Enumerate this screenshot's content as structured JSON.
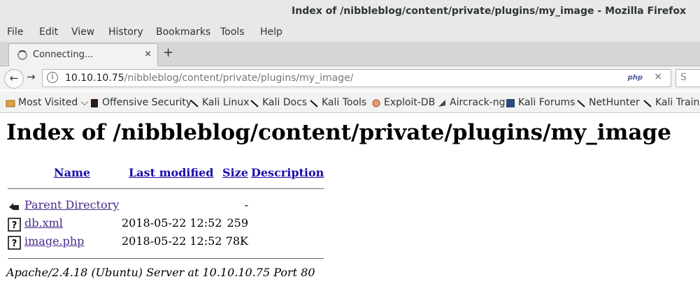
{
  "window": {
    "title": "Index of /nibbleblog/content/private/plugins/my_image - Mozilla Firefox"
  },
  "menu": [
    "File",
    "Edit",
    "View",
    "History",
    "Bookmarks",
    "Tools",
    "Help"
  ],
  "tab": {
    "label": "Connecting...",
    "close": "×"
  },
  "newtab": "+",
  "nav": {
    "back": "←",
    "forward": "→",
    "url_host": "10.10.10.75",
    "url_path": "/nibbleblog/content/private/plugins/my_image/",
    "php_badge": "php",
    "clear": "×",
    "search_placeholder": "S"
  },
  "bookmarks": [
    {
      "label": "Most Visited ⌵",
      "icon": "folder-icon"
    },
    {
      "label": "Offensive Security",
      "icon": "offsec-icon"
    },
    {
      "label": "Kali Linux",
      "icon": "kali-dragon-icon"
    },
    {
      "label": "Kali Docs",
      "icon": "kali-dragon-icon"
    },
    {
      "label": "Kali Tools",
      "icon": "kali-dragon-icon"
    },
    {
      "label": "Exploit-DB",
      "icon": "exploitdb-icon"
    },
    {
      "label": "Aircrack-ng",
      "icon": "aircrack-icon"
    },
    {
      "label": "Kali Forums",
      "icon": "forums-icon"
    },
    {
      "label": "NetHunter",
      "icon": "kali-dragon-icon"
    },
    {
      "label": "Kali Trainin",
      "icon": "kali-dragon-icon"
    }
  ],
  "page": {
    "heading": "Index of /nibbleblog/content/private/plugins/my_image",
    "columns": {
      "name": "Name",
      "modified": "Last modified",
      "size": "Size",
      "description": "Description"
    },
    "rows": [
      {
        "name": "Parent Directory",
        "modified": "",
        "size": "-",
        "icon": "back-folder-icon"
      },
      {
        "name": "db.xml",
        "modified": "2018-05-22 12:52",
        "size": "259",
        "icon": "unknown-file-icon"
      },
      {
        "name": "image.php",
        "modified": "2018-05-22 12:52",
        "size": "78K",
        "icon": "unknown-file-icon"
      }
    ],
    "address": "Apache/2.4.18 (Ubuntu) Server at 10.10.10.75 Port 80"
  }
}
